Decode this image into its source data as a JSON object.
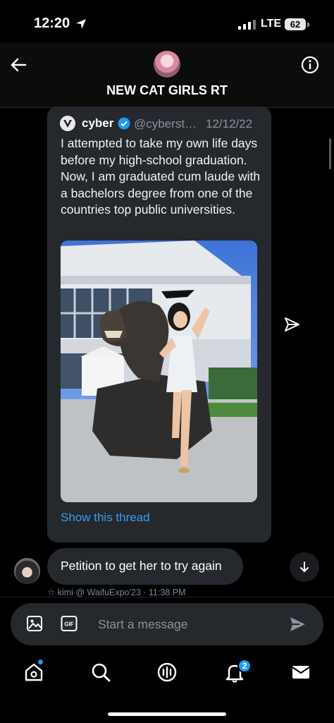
{
  "status_bar": {
    "time": "12:20",
    "network": "LTE",
    "battery": "62"
  },
  "header": {
    "title": "NEW CAT GIRLS RT"
  },
  "quoted_tweet": {
    "author_name": "cyber",
    "handle": "@cyberst…",
    "date": "12/12/22",
    "text": "I attempted to take my own life days before my high-school graduation. Now, I am graduated cum laude with a bachelors degree from one of the countries top public universities.",
    "show_thread_label": "Show this thread"
  },
  "message": {
    "text": "Petition to get her to try again",
    "meta": "☆ kimi @ WaifuExpo'23 · 11:38 PM"
  },
  "compose": {
    "placeholder": "Start a message"
  },
  "tab_bar": {
    "notifications_count": "2"
  },
  "colors": {
    "accent": "#1d9bf0",
    "link": "#3d9be9",
    "card_bg": "#25282d"
  }
}
